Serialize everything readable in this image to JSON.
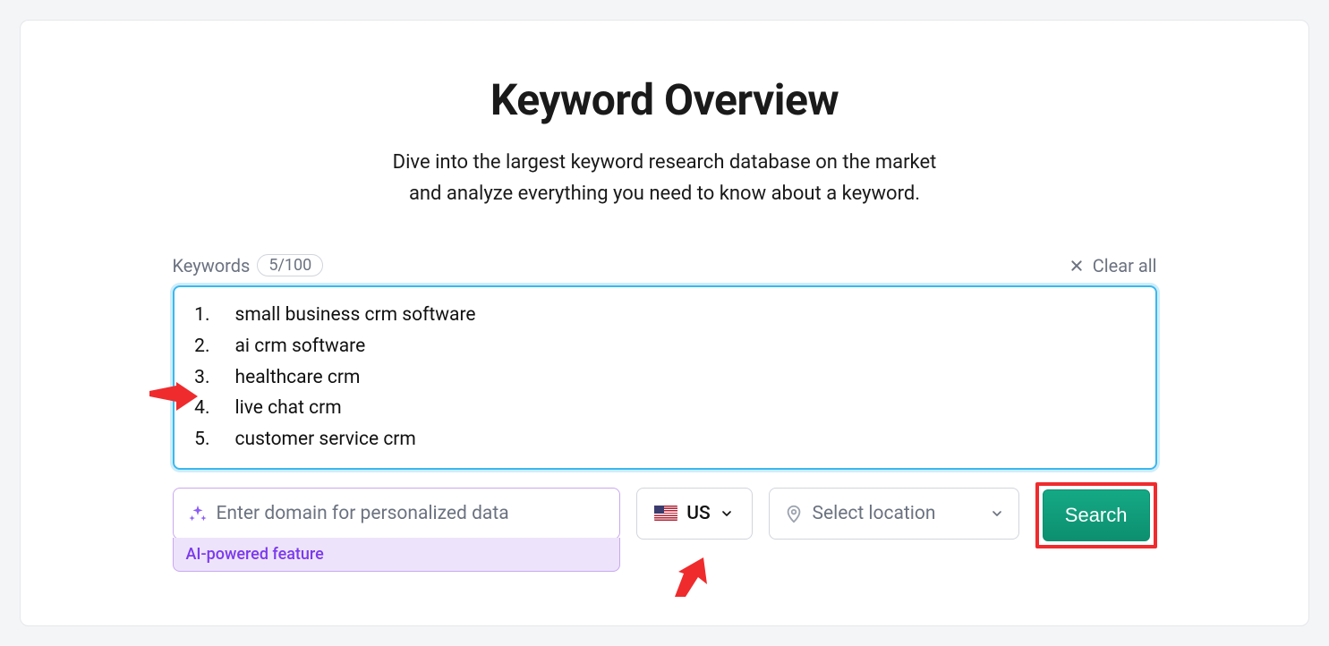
{
  "header": {
    "title": "Keyword Overview",
    "subtitle_line1": "Dive into the largest keyword research database on the market",
    "subtitle_line2": "and analyze everything you need to know about a keyword."
  },
  "keywords": {
    "label": "Keywords",
    "counter": "5/100",
    "clear_label": "Clear all",
    "items": [
      "small business crm software",
      "ai crm software",
      "healthcare crm",
      "live chat crm",
      "customer service crm"
    ]
  },
  "domain": {
    "placeholder": "Enter domain for personalized data",
    "ai_badge": "AI-powered feature"
  },
  "country": {
    "code": "US"
  },
  "location": {
    "placeholder": "Select location"
  },
  "actions": {
    "search": "Search"
  }
}
